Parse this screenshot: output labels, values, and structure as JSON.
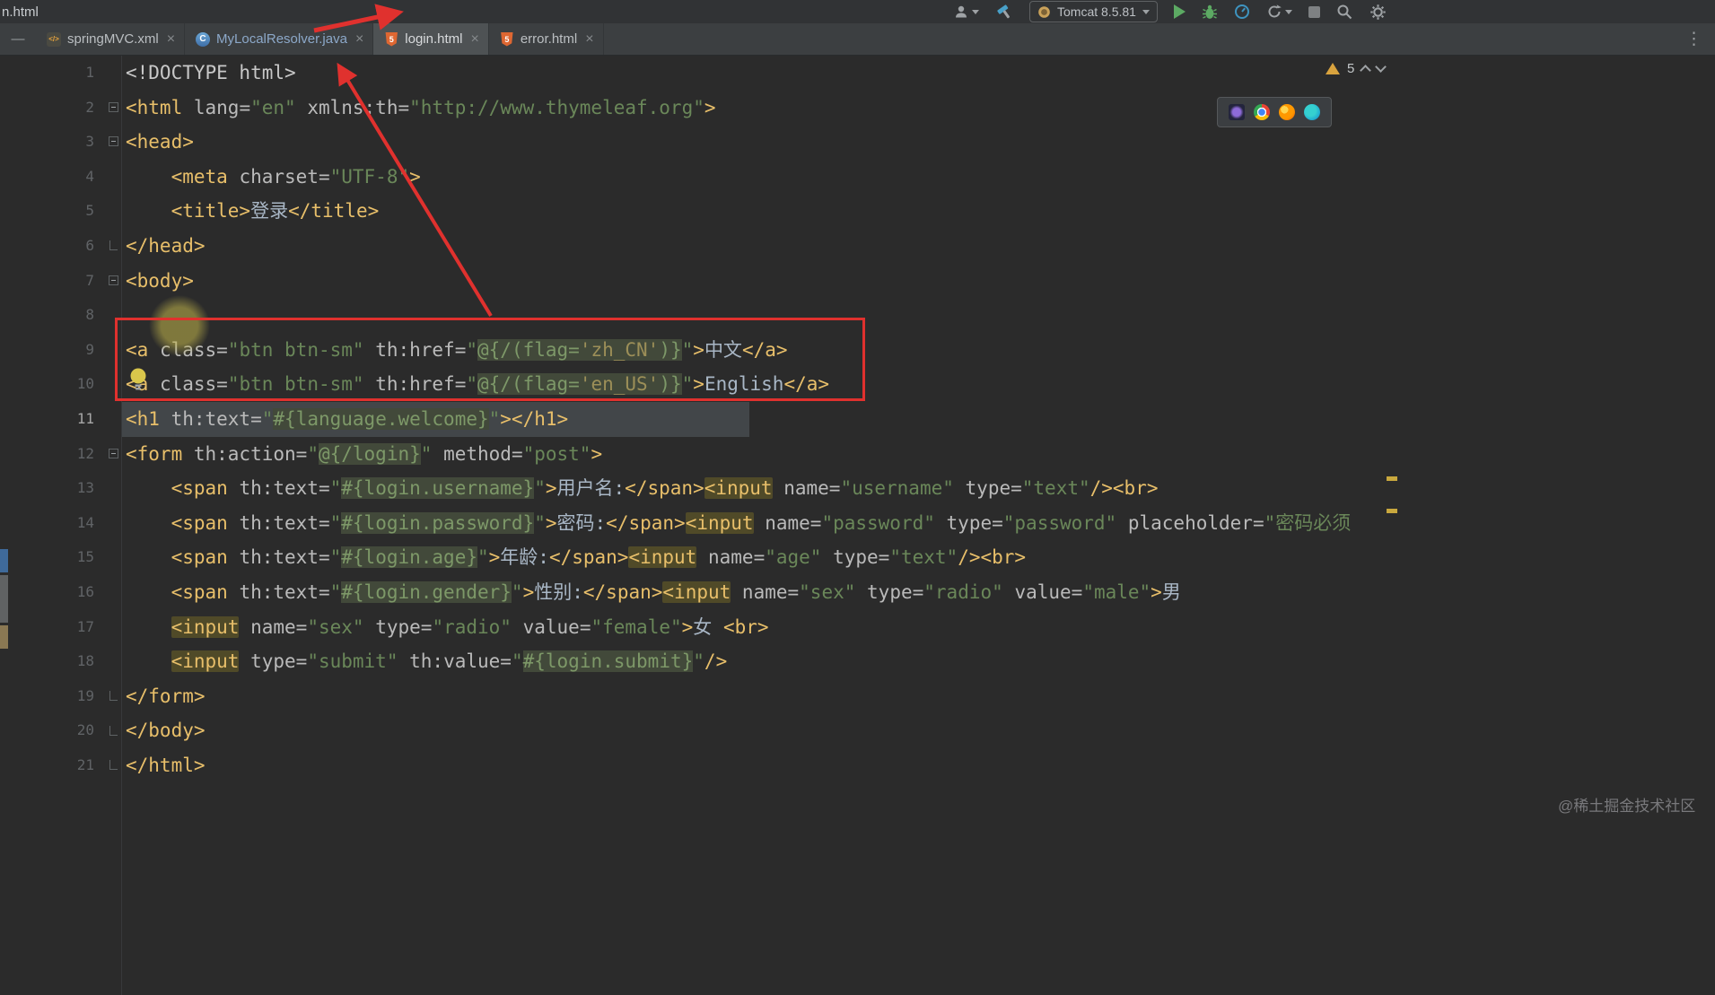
{
  "window": {
    "title": "n.html"
  },
  "titlebar": {
    "run_config": "Tomcat 8.5.81"
  },
  "tabbar": {
    "tabs": [
      {
        "label": "springMVC.xml",
        "icon": "xml-file-icon",
        "selected": false,
        "modified": false
      },
      {
        "label": "MyLocalResolver.java",
        "icon": "java-class-icon",
        "selected": false,
        "modified": true
      },
      {
        "label": "login.html",
        "icon": "html-file-icon",
        "selected": true,
        "modified": false
      },
      {
        "label": "error.html",
        "icon": "html-file-icon",
        "selected": false,
        "modified": false
      }
    ]
  },
  "editor": {
    "inspections": {
      "warning_count": "5"
    },
    "lines": [
      {
        "n": 1,
        "seg": [
          [
            "meta",
            "<!DOCTYPE html>"
          ]
        ]
      },
      {
        "n": 2,
        "fold": "start",
        "seg": [
          [
            "tag",
            "<html "
          ],
          [
            "attr",
            "lang"
          ],
          [
            "attr",
            "="
          ],
          [
            "str",
            "\"en\""
          ],
          [
            "plain",
            " "
          ],
          [
            "attr",
            "xmlns:th"
          ],
          [
            "attr",
            "="
          ],
          [
            "str",
            "\"http://www.thymeleaf.org\""
          ],
          [
            "tag",
            ">"
          ]
        ]
      },
      {
        "n": 3,
        "fold": "start",
        "seg": [
          [
            "tag",
            "<head>"
          ]
        ]
      },
      {
        "n": 4,
        "seg": [
          [
            "plain",
            "    "
          ],
          [
            "tag",
            "<meta "
          ],
          [
            "attr",
            "charset"
          ],
          [
            "attr",
            "="
          ],
          [
            "str",
            "\"UTF-8\""
          ],
          [
            "tag",
            ">"
          ]
        ]
      },
      {
        "n": 5,
        "seg": [
          [
            "plain",
            "    "
          ],
          [
            "tag",
            "<title>"
          ],
          [
            "text",
            "登录"
          ],
          [
            "tag",
            "</title>"
          ]
        ]
      },
      {
        "n": 6,
        "fold": "end",
        "seg": [
          [
            "tag",
            "</head>"
          ]
        ]
      },
      {
        "n": 7,
        "fold": "start",
        "seg": [
          [
            "tag",
            "<body>"
          ]
        ]
      },
      {
        "n": 8,
        "seg": []
      },
      {
        "n": 9,
        "seg": [
          [
            "tag",
            "<a "
          ],
          [
            "attr",
            "class"
          ],
          [
            "attr",
            "="
          ],
          [
            "str",
            "\"btn btn-sm\""
          ],
          [
            "plain",
            " "
          ],
          [
            "attr",
            "th:href"
          ],
          [
            "attr",
            "="
          ],
          [
            "str",
            "\""
          ],
          [
            "expr",
            "@{/(flag="
          ],
          [
            "exprs",
            "'zh_CN'"
          ],
          [
            "expr",
            ")}"
          ],
          [
            "str",
            "\""
          ],
          [
            "tag",
            ">"
          ],
          [
            "text",
            "中文"
          ],
          [
            "tag",
            "</a>"
          ]
        ]
      },
      {
        "n": 10,
        "seg": [
          [
            "tag",
            "<a "
          ],
          [
            "attr",
            "class"
          ],
          [
            "attr",
            "="
          ],
          [
            "str",
            "\"btn btn-sm\""
          ],
          [
            "plain",
            " "
          ],
          [
            "attr",
            "th:href"
          ],
          [
            "attr",
            "="
          ],
          [
            "str",
            "\""
          ],
          [
            "expr",
            "@{/(flag="
          ],
          [
            "exprs",
            "'en_US'"
          ],
          [
            "expr",
            ")}"
          ],
          [
            "str",
            "\""
          ],
          [
            "tag",
            ">"
          ],
          [
            "text",
            "English"
          ],
          [
            "tag",
            "</a>"
          ]
        ]
      },
      {
        "n": 11,
        "band": true,
        "cur": true,
        "seg": [
          [
            "tag",
            "<h1 "
          ],
          [
            "attr",
            "th:text"
          ],
          [
            "attr",
            "="
          ],
          [
            "str",
            "\""
          ],
          [
            "expr",
            "#{language.welcome}"
          ],
          [
            "str",
            "\""
          ],
          [
            "tag",
            "></h1>"
          ]
        ]
      },
      {
        "n": 12,
        "fold": "start",
        "seg": [
          [
            "tag",
            "<form "
          ],
          [
            "attr",
            "th:action"
          ],
          [
            "attr",
            "="
          ],
          [
            "str",
            "\""
          ],
          [
            "expr",
            "@{/login}"
          ],
          [
            "str",
            "\""
          ],
          [
            "plain",
            " "
          ],
          [
            "attr",
            "method"
          ],
          [
            "attr",
            "="
          ],
          [
            "str",
            "\"post\""
          ],
          [
            "tag",
            ">"
          ]
        ]
      },
      {
        "n": 13,
        "seg": [
          [
            "plain",
            "    "
          ],
          [
            "tag",
            "<span "
          ],
          [
            "attr",
            "th:text"
          ],
          [
            "attr",
            "="
          ],
          [
            "str",
            "\""
          ],
          [
            "expr",
            "#{login.username}"
          ],
          [
            "str",
            "\""
          ],
          [
            "tag",
            ">"
          ],
          [
            "text",
            "用户名:"
          ],
          [
            "tag",
            "</span>"
          ],
          [
            "warn",
            "<input"
          ],
          [
            "plain",
            " "
          ],
          [
            "attr",
            "name"
          ],
          [
            "attr",
            "="
          ],
          [
            "str",
            "\"username\""
          ],
          [
            "plain",
            " "
          ],
          [
            "attr",
            "type"
          ],
          [
            "attr",
            "="
          ],
          [
            "str",
            "\"text\""
          ],
          [
            "tag",
            "/><br>"
          ]
        ]
      },
      {
        "n": 14,
        "seg": [
          [
            "plain",
            "    "
          ],
          [
            "tag",
            "<span "
          ],
          [
            "attr",
            "th:text"
          ],
          [
            "attr",
            "="
          ],
          [
            "str",
            "\""
          ],
          [
            "expr",
            "#{login.password}"
          ],
          [
            "str",
            "\""
          ],
          [
            "tag",
            ">"
          ],
          [
            "text",
            "密码:"
          ],
          [
            "tag",
            "</span>"
          ],
          [
            "warn",
            "<input"
          ],
          [
            "plain",
            " "
          ],
          [
            "attr",
            "name"
          ],
          [
            "attr",
            "="
          ],
          [
            "str",
            "\"password\""
          ],
          [
            "plain",
            " "
          ],
          [
            "attr",
            "type"
          ],
          [
            "attr",
            "="
          ],
          [
            "str",
            "\"password\""
          ],
          [
            "plain",
            " "
          ],
          [
            "attr",
            "placeholder"
          ],
          [
            "attr",
            "="
          ],
          [
            "str",
            "\"密码必须"
          ]
        ]
      },
      {
        "n": 15,
        "seg": [
          [
            "plain",
            "    "
          ],
          [
            "tag",
            "<span "
          ],
          [
            "attr",
            "th:text"
          ],
          [
            "attr",
            "="
          ],
          [
            "str",
            "\""
          ],
          [
            "expr",
            "#{login.age}"
          ],
          [
            "str",
            "\""
          ],
          [
            "tag",
            ">"
          ],
          [
            "text",
            "年龄:"
          ],
          [
            "tag",
            "</span>"
          ],
          [
            "warn",
            "<input"
          ],
          [
            "plain",
            " "
          ],
          [
            "attr",
            "name"
          ],
          [
            "attr",
            "="
          ],
          [
            "str",
            "\"age\""
          ],
          [
            "plain",
            " "
          ],
          [
            "attr",
            "type"
          ],
          [
            "attr",
            "="
          ],
          [
            "str",
            "\"text\""
          ],
          [
            "tag",
            "/><br>"
          ]
        ]
      },
      {
        "n": 16,
        "seg": [
          [
            "plain",
            "    "
          ],
          [
            "tag",
            "<span "
          ],
          [
            "attr",
            "th:text"
          ],
          [
            "attr",
            "="
          ],
          [
            "str",
            "\""
          ],
          [
            "expr",
            "#{login.gender}"
          ],
          [
            "str",
            "\""
          ],
          [
            "tag",
            ">"
          ],
          [
            "text",
            "性别:"
          ],
          [
            "tag",
            "</span>"
          ],
          [
            "warn",
            "<input"
          ],
          [
            "plain",
            " "
          ],
          [
            "attr",
            "name"
          ],
          [
            "attr",
            "="
          ],
          [
            "str",
            "\"sex\""
          ],
          [
            "plain",
            " "
          ],
          [
            "attr",
            "type"
          ],
          [
            "attr",
            "="
          ],
          [
            "str",
            "\"radio\""
          ],
          [
            "plain",
            " "
          ],
          [
            "attr",
            "value"
          ],
          [
            "attr",
            "="
          ],
          [
            "str",
            "\"male\""
          ],
          [
            "tag",
            ">"
          ],
          [
            "text",
            "男"
          ]
        ]
      },
      {
        "n": 17,
        "seg": [
          [
            "plain",
            "    "
          ],
          [
            "warn",
            "<input"
          ],
          [
            "plain",
            " "
          ],
          [
            "attr",
            "name"
          ],
          [
            "attr",
            "="
          ],
          [
            "str",
            "\"sex\""
          ],
          [
            "plain",
            " "
          ],
          [
            "attr",
            "type"
          ],
          [
            "attr",
            "="
          ],
          [
            "str",
            "\"radio\""
          ],
          [
            "plain",
            " "
          ],
          [
            "attr",
            "value"
          ],
          [
            "attr",
            "="
          ],
          [
            "str",
            "\"female\""
          ],
          [
            "tag",
            ">"
          ],
          [
            "text",
            "女 "
          ],
          [
            "tag",
            "<br>"
          ]
        ]
      },
      {
        "n": 18,
        "seg": [
          [
            "plain",
            "    "
          ],
          [
            "warn",
            "<input"
          ],
          [
            "plain",
            " "
          ],
          [
            "attr",
            "type"
          ],
          [
            "attr",
            "="
          ],
          [
            "str",
            "\"submit\""
          ],
          [
            "plain",
            " "
          ],
          [
            "attr",
            "th:value"
          ],
          [
            "attr",
            "="
          ],
          [
            "str",
            "\""
          ],
          [
            "expr",
            "#{login.submit}"
          ],
          [
            "str",
            "\""
          ],
          [
            "tag",
            "/>"
          ]
        ]
      },
      {
        "n": 19,
        "fold": "end",
        "seg": [
          [
            "tag",
            "</form>"
          ]
        ]
      },
      {
        "n": 20,
        "fold": "end",
        "seg": [
          [
            "tag",
            "</body>"
          ]
        ]
      },
      {
        "n": 21,
        "fold": "end",
        "seg": [
          [
            "tag",
            "</html>"
          ]
        ]
      }
    ]
  },
  "watermark": "@稀土掘金技术社区",
  "colors": {
    "annotation_red": "#e0312e",
    "highlight_circle": "rgba(196,183,75,0.55)",
    "warning_yellow": "#d9a33e",
    "accent_tag": "#e8bf6a",
    "accent_string": "#6a8759"
  }
}
